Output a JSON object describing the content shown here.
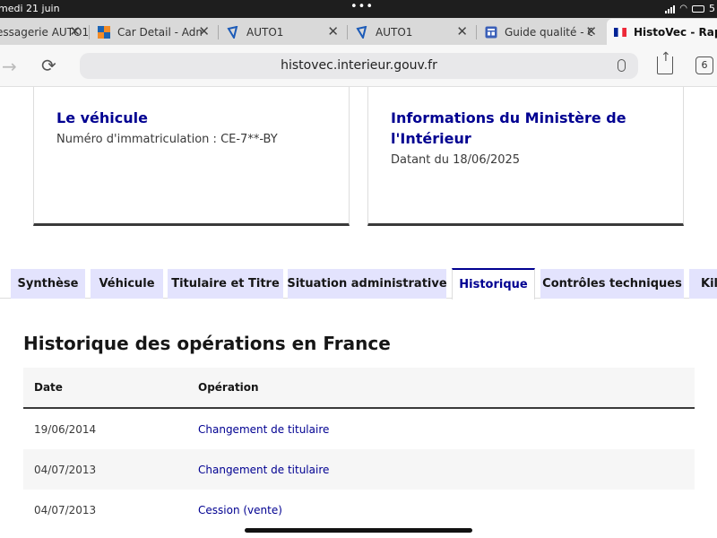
{
  "status_bar": {
    "time": "medi 21 juin",
    "dots": "•••",
    "battery": "5"
  },
  "browser_tabs": [
    {
      "title": "essagerie AUTO1",
      "favicon": "none",
      "active": false
    },
    {
      "title": "Car Detail - Admin",
      "favicon": "square-logo",
      "active": false
    },
    {
      "title": "AUTO1",
      "favicon": "auto1-logo",
      "active": false
    },
    {
      "title": "AUTO1",
      "favicon": "auto1-logo",
      "active": false
    },
    {
      "title": "Guide qualité - C",
      "favicon": "doc-logo",
      "active": false
    },
    {
      "title": "HistoVec - Rapport",
      "favicon": "french-flag",
      "active": true
    }
  ],
  "tab_close_glyph": "✕",
  "address_bar": {
    "url": "histovec.interieur.gouv.fr",
    "tab_count": "6"
  },
  "cards": {
    "vehicle": {
      "title": "Le véhicule",
      "text": "Numéro d'immatriculation : CE-7**-BY"
    },
    "ministry": {
      "title": "Informations du Ministère de l'Intérieur",
      "text": "Datant du 18/06/2025"
    }
  },
  "report_tabs": [
    {
      "label": "Synthèse"
    },
    {
      "label": "Véhicule"
    },
    {
      "label": "Titulaire et Titre"
    },
    {
      "label": "Situation administrative"
    },
    {
      "label": "Historique",
      "selected": true
    },
    {
      "label": "Contrôles techniques"
    },
    {
      "label": "Kilo"
    }
  ],
  "history": {
    "title": "Historique des opérations en France",
    "columns": [
      "Date",
      "Opération"
    ],
    "rows": [
      {
        "date": "19/06/2014",
        "operation": "Changement de titulaire"
      },
      {
        "date": "04/07/2013",
        "operation": "Changement de titulaire"
      },
      {
        "date": "04/07/2013",
        "operation": "Cession (vente)"
      }
    ]
  },
  "colors": {
    "accent": "#000091",
    "tab_bg": "#e3e3fd",
    "row_alt": "#f6f6f6"
  }
}
